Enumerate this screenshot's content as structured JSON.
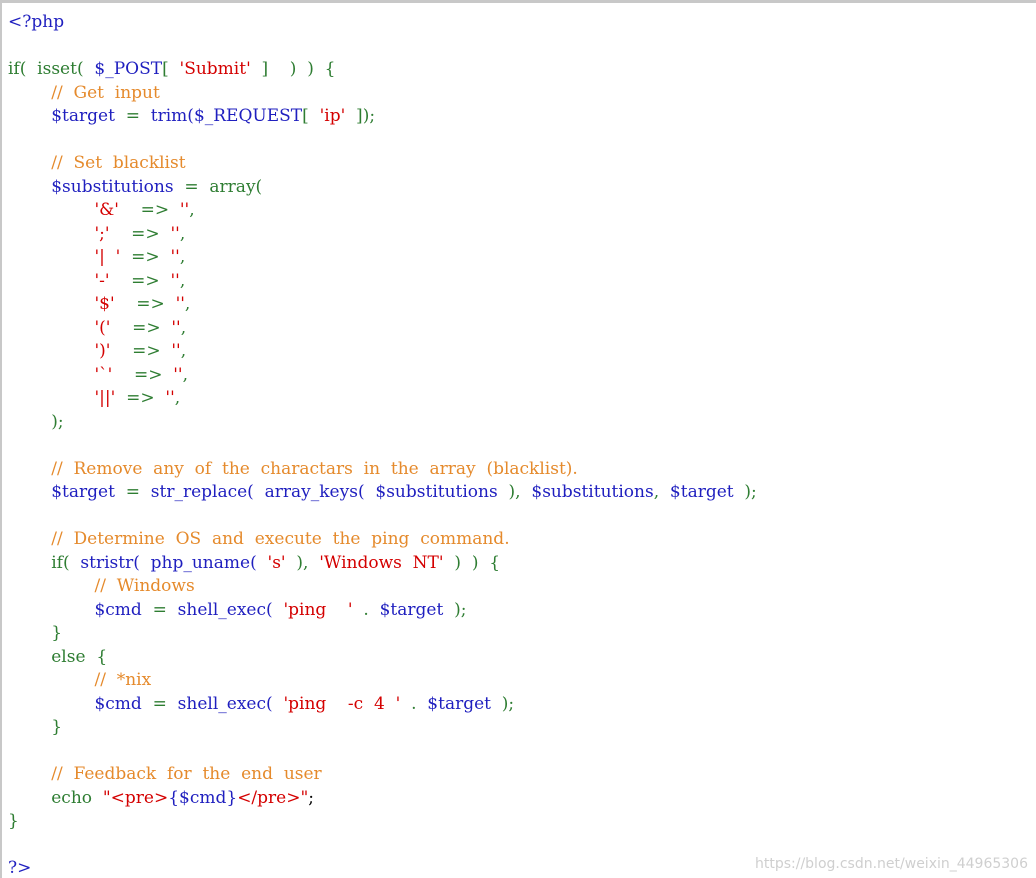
{
  "colors": {
    "keyword_green": "#2e7d32",
    "variable_blue": "#1f1fbf",
    "string_red": "#d40000",
    "comment_orange": "#e58a2c",
    "text_black": "#000000",
    "background": "#ffffff",
    "watermark_gray": "#cfcfcf"
  },
  "code_lines": [
    [
      {
        "t": "<?php",
        "c": "blue"
      }
    ],
    [],
    [
      {
        "t": "if(  ",
        "c": "green"
      },
      {
        "t": "isset(  ",
        "c": "green"
      },
      {
        "t": "$_POST",
        "c": "blue"
      },
      {
        "t": "[  ",
        "c": "green"
      },
      {
        "t": "'Submit'",
        "c": "red"
      },
      {
        "t": "  ]    )  )  {",
        "c": "green"
      }
    ],
    [
      {
        "t": "        ",
        "c": "black"
      },
      {
        "t": "//  Get  input",
        "c": "orange"
      }
    ],
    [
      {
        "t": "        ",
        "c": "black"
      },
      {
        "t": "$target",
        "c": "blue"
      },
      {
        "t": "  =  ",
        "c": "green"
      },
      {
        "t": "trim(",
        "c": "blue"
      },
      {
        "t": "$_REQUEST",
        "c": "blue"
      },
      {
        "t": "[  ",
        "c": "green"
      },
      {
        "t": "'ip'",
        "c": "red"
      },
      {
        "t": "  ]);",
        "c": "green"
      }
    ],
    [],
    [
      {
        "t": "        ",
        "c": "black"
      },
      {
        "t": "//  Set  blacklist",
        "c": "orange"
      }
    ],
    [
      {
        "t": "        ",
        "c": "black"
      },
      {
        "t": "$substitutions",
        "c": "blue"
      },
      {
        "t": "  =  array(",
        "c": "green"
      }
    ],
    [
      {
        "t": "                ",
        "c": "black"
      },
      {
        "t": "'&'",
        "c": "red"
      },
      {
        "t": "    =>  ",
        "c": "green"
      },
      {
        "t": "''",
        "c": "red"
      },
      {
        "t": ",",
        "c": "green"
      }
    ],
    [
      {
        "t": "                ",
        "c": "black"
      },
      {
        "t": "';'",
        "c": "red"
      },
      {
        "t": "    =>  ",
        "c": "green"
      },
      {
        "t": "''",
        "c": "red"
      },
      {
        "t": ",",
        "c": "green"
      }
    ],
    [
      {
        "t": "                ",
        "c": "black"
      },
      {
        "t": "'|  '",
        "c": "red"
      },
      {
        "t": "  =>  ",
        "c": "green"
      },
      {
        "t": "''",
        "c": "red"
      },
      {
        "t": ",",
        "c": "green"
      }
    ],
    [
      {
        "t": "                ",
        "c": "black"
      },
      {
        "t": "'-'",
        "c": "red"
      },
      {
        "t": "    =>  ",
        "c": "green"
      },
      {
        "t": "''",
        "c": "red"
      },
      {
        "t": ",",
        "c": "green"
      }
    ],
    [
      {
        "t": "                ",
        "c": "black"
      },
      {
        "t": "'$'",
        "c": "red"
      },
      {
        "t": "    =>  ",
        "c": "green"
      },
      {
        "t": "''",
        "c": "red"
      },
      {
        "t": ",",
        "c": "green"
      }
    ],
    [
      {
        "t": "                ",
        "c": "black"
      },
      {
        "t": "'('",
        "c": "red"
      },
      {
        "t": "    =>  ",
        "c": "green"
      },
      {
        "t": "''",
        "c": "red"
      },
      {
        "t": ",",
        "c": "green"
      }
    ],
    [
      {
        "t": "                ",
        "c": "black"
      },
      {
        "t": "')'",
        "c": "red"
      },
      {
        "t": "    =>  ",
        "c": "green"
      },
      {
        "t": "''",
        "c": "red"
      },
      {
        "t": ",",
        "c": "green"
      }
    ],
    [
      {
        "t": "                ",
        "c": "black"
      },
      {
        "t": "'`'",
        "c": "red"
      },
      {
        "t": "    =>  ",
        "c": "green"
      },
      {
        "t": "''",
        "c": "red"
      },
      {
        "t": ",",
        "c": "green"
      }
    ],
    [
      {
        "t": "                ",
        "c": "black"
      },
      {
        "t": "'||'",
        "c": "red"
      },
      {
        "t": "  =>  ",
        "c": "green"
      },
      {
        "t": "''",
        "c": "red"
      },
      {
        "t": ",",
        "c": "green"
      }
    ],
    [
      {
        "t": "        );",
        "c": "green"
      }
    ],
    [],
    [
      {
        "t": "        ",
        "c": "black"
      },
      {
        "t": "//  Remove  any  of  the  charactars  in  the  array  (blacklist).",
        "c": "orange"
      }
    ],
    [
      {
        "t": "        ",
        "c": "black"
      },
      {
        "t": "$target",
        "c": "blue"
      },
      {
        "t": "  =  ",
        "c": "green"
      },
      {
        "t": "str_replace(  array_keys(  ",
        "c": "blue"
      },
      {
        "t": "$substitutions",
        "c": "blue"
      },
      {
        "t": "  ),  ",
        "c": "green"
      },
      {
        "t": "$substitutions",
        "c": "blue"
      },
      {
        "t": ",  ",
        "c": "green"
      },
      {
        "t": "$target",
        "c": "blue"
      },
      {
        "t": "  );",
        "c": "green"
      }
    ],
    [],
    [
      {
        "t": "        ",
        "c": "black"
      },
      {
        "t": "//  Determine  OS  and  execute  the  ping  command.",
        "c": "orange"
      }
    ],
    [
      {
        "t": "        ",
        "c": "black"
      },
      {
        "t": "if(  ",
        "c": "green"
      },
      {
        "t": "stristr(  php_uname(  ",
        "c": "blue"
      },
      {
        "t": "'s'",
        "c": "red"
      },
      {
        "t": "  ),  ",
        "c": "green"
      },
      {
        "t": "'Windows  NT'",
        "c": "red"
      },
      {
        "t": "  )  )  {",
        "c": "green"
      }
    ],
    [
      {
        "t": "                ",
        "c": "black"
      },
      {
        "t": "//  Windows",
        "c": "orange"
      }
    ],
    [
      {
        "t": "                ",
        "c": "black"
      },
      {
        "t": "$cmd",
        "c": "blue"
      },
      {
        "t": "  =  ",
        "c": "green"
      },
      {
        "t": "shell_exec(  ",
        "c": "blue"
      },
      {
        "t": "'ping    '",
        "c": "red"
      },
      {
        "t": "  .  ",
        "c": "green"
      },
      {
        "t": "$target",
        "c": "blue"
      },
      {
        "t": "  );",
        "c": "green"
      }
    ],
    [
      {
        "t": "        }",
        "c": "green"
      }
    ],
    [
      {
        "t": "        else  {",
        "c": "green"
      }
    ],
    [
      {
        "t": "                ",
        "c": "black"
      },
      {
        "t": "//  *nix",
        "c": "orange"
      }
    ],
    [
      {
        "t": "                ",
        "c": "black"
      },
      {
        "t": "$cmd",
        "c": "blue"
      },
      {
        "t": "  =  ",
        "c": "green"
      },
      {
        "t": "shell_exec(  ",
        "c": "blue"
      },
      {
        "t": "'ping    -c  4  '",
        "c": "red"
      },
      {
        "t": "  .  ",
        "c": "green"
      },
      {
        "t": "$target",
        "c": "blue"
      },
      {
        "t": "  );",
        "c": "green"
      }
    ],
    [
      {
        "t": "        }",
        "c": "green"
      }
    ],
    [],
    [
      {
        "t": "        ",
        "c": "black"
      },
      {
        "t": "//  Feedback  for  the  end  user",
        "c": "orange"
      }
    ],
    [
      {
        "t": "        ",
        "c": "black"
      },
      {
        "t": "echo  ",
        "c": "green"
      },
      {
        "t": "\"<pre>",
        "c": "red"
      },
      {
        "t": "{$cmd}",
        "c": "blue"
      },
      {
        "t": "</pre>\"",
        "c": "red"
      },
      {
        "t": ";",
        "c": "black"
      }
    ],
    [
      {
        "t": "}",
        "c": "green"
      }
    ],
    [],
    [
      {
        "t": "?>",
        "c": "blue"
      }
    ]
  ],
  "watermark": "https://blog.csdn.net/weixin_44965306"
}
